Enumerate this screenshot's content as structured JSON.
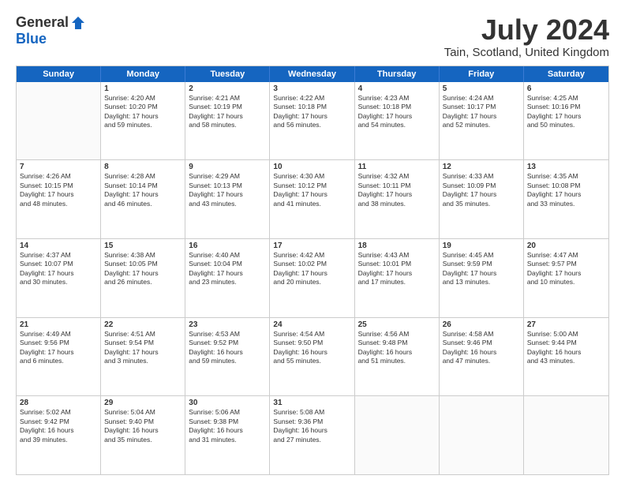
{
  "header": {
    "logo_general": "General",
    "logo_blue": "Blue",
    "month_title": "July 2024",
    "location": "Tain, Scotland, United Kingdom"
  },
  "days_of_week": [
    "Sunday",
    "Monday",
    "Tuesday",
    "Wednesday",
    "Thursday",
    "Friday",
    "Saturday"
  ],
  "weeks": [
    [
      {
        "day": "",
        "empty": true,
        "lines": []
      },
      {
        "day": "1",
        "lines": [
          "Sunrise: 4:20 AM",
          "Sunset: 10:20 PM",
          "Daylight: 17 hours",
          "and 59 minutes."
        ]
      },
      {
        "day": "2",
        "lines": [
          "Sunrise: 4:21 AM",
          "Sunset: 10:19 PM",
          "Daylight: 17 hours",
          "and 58 minutes."
        ]
      },
      {
        "day": "3",
        "lines": [
          "Sunrise: 4:22 AM",
          "Sunset: 10:18 PM",
          "Daylight: 17 hours",
          "and 56 minutes."
        ]
      },
      {
        "day": "4",
        "lines": [
          "Sunrise: 4:23 AM",
          "Sunset: 10:18 PM",
          "Daylight: 17 hours",
          "and 54 minutes."
        ]
      },
      {
        "day": "5",
        "lines": [
          "Sunrise: 4:24 AM",
          "Sunset: 10:17 PM",
          "Daylight: 17 hours",
          "and 52 minutes."
        ]
      },
      {
        "day": "6",
        "lines": [
          "Sunrise: 4:25 AM",
          "Sunset: 10:16 PM",
          "Daylight: 17 hours",
          "and 50 minutes."
        ]
      }
    ],
    [
      {
        "day": "7",
        "lines": [
          "Sunrise: 4:26 AM",
          "Sunset: 10:15 PM",
          "Daylight: 17 hours",
          "and 48 minutes."
        ]
      },
      {
        "day": "8",
        "lines": [
          "Sunrise: 4:28 AM",
          "Sunset: 10:14 PM",
          "Daylight: 17 hours",
          "and 46 minutes."
        ]
      },
      {
        "day": "9",
        "lines": [
          "Sunrise: 4:29 AM",
          "Sunset: 10:13 PM",
          "Daylight: 17 hours",
          "and 43 minutes."
        ]
      },
      {
        "day": "10",
        "lines": [
          "Sunrise: 4:30 AM",
          "Sunset: 10:12 PM",
          "Daylight: 17 hours",
          "and 41 minutes."
        ]
      },
      {
        "day": "11",
        "lines": [
          "Sunrise: 4:32 AM",
          "Sunset: 10:11 PM",
          "Daylight: 17 hours",
          "and 38 minutes."
        ]
      },
      {
        "day": "12",
        "lines": [
          "Sunrise: 4:33 AM",
          "Sunset: 10:09 PM",
          "Daylight: 17 hours",
          "and 35 minutes."
        ]
      },
      {
        "day": "13",
        "lines": [
          "Sunrise: 4:35 AM",
          "Sunset: 10:08 PM",
          "Daylight: 17 hours",
          "and 33 minutes."
        ]
      }
    ],
    [
      {
        "day": "14",
        "lines": [
          "Sunrise: 4:37 AM",
          "Sunset: 10:07 PM",
          "Daylight: 17 hours",
          "and 30 minutes."
        ]
      },
      {
        "day": "15",
        "lines": [
          "Sunrise: 4:38 AM",
          "Sunset: 10:05 PM",
          "Daylight: 17 hours",
          "and 26 minutes."
        ]
      },
      {
        "day": "16",
        "lines": [
          "Sunrise: 4:40 AM",
          "Sunset: 10:04 PM",
          "Daylight: 17 hours",
          "and 23 minutes."
        ]
      },
      {
        "day": "17",
        "lines": [
          "Sunrise: 4:42 AM",
          "Sunset: 10:02 PM",
          "Daylight: 17 hours",
          "and 20 minutes."
        ]
      },
      {
        "day": "18",
        "lines": [
          "Sunrise: 4:43 AM",
          "Sunset: 10:01 PM",
          "Daylight: 17 hours",
          "and 17 minutes."
        ]
      },
      {
        "day": "19",
        "lines": [
          "Sunrise: 4:45 AM",
          "Sunset: 9:59 PM",
          "Daylight: 17 hours",
          "and 13 minutes."
        ]
      },
      {
        "day": "20",
        "lines": [
          "Sunrise: 4:47 AM",
          "Sunset: 9:57 PM",
          "Daylight: 17 hours",
          "and 10 minutes."
        ]
      }
    ],
    [
      {
        "day": "21",
        "lines": [
          "Sunrise: 4:49 AM",
          "Sunset: 9:56 PM",
          "Daylight: 17 hours",
          "and 6 minutes."
        ]
      },
      {
        "day": "22",
        "lines": [
          "Sunrise: 4:51 AM",
          "Sunset: 9:54 PM",
          "Daylight: 17 hours",
          "and 3 minutes."
        ]
      },
      {
        "day": "23",
        "lines": [
          "Sunrise: 4:53 AM",
          "Sunset: 9:52 PM",
          "Daylight: 16 hours",
          "and 59 minutes."
        ]
      },
      {
        "day": "24",
        "lines": [
          "Sunrise: 4:54 AM",
          "Sunset: 9:50 PM",
          "Daylight: 16 hours",
          "and 55 minutes."
        ]
      },
      {
        "day": "25",
        "lines": [
          "Sunrise: 4:56 AM",
          "Sunset: 9:48 PM",
          "Daylight: 16 hours",
          "and 51 minutes."
        ]
      },
      {
        "day": "26",
        "lines": [
          "Sunrise: 4:58 AM",
          "Sunset: 9:46 PM",
          "Daylight: 16 hours",
          "and 47 minutes."
        ]
      },
      {
        "day": "27",
        "lines": [
          "Sunrise: 5:00 AM",
          "Sunset: 9:44 PM",
          "Daylight: 16 hours",
          "and 43 minutes."
        ]
      }
    ],
    [
      {
        "day": "28",
        "lines": [
          "Sunrise: 5:02 AM",
          "Sunset: 9:42 PM",
          "Daylight: 16 hours",
          "and 39 minutes."
        ]
      },
      {
        "day": "29",
        "lines": [
          "Sunrise: 5:04 AM",
          "Sunset: 9:40 PM",
          "Daylight: 16 hours",
          "and 35 minutes."
        ]
      },
      {
        "day": "30",
        "lines": [
          "Sunrise: 5:06 AM",
          "Sunset: 9:38 PM",
          "Daylight: 16 hours",
          "and 31 minutes."
        ]
      },
      {
        "day": "31",
        "lines": [
          "Sunrise: 5:08 AM",
          "Sunset: 9:36 PM",
          "Daylight: 16 hours",
          "and 27 minutes."
        ]
      },
      {
        "day": "",
        "empty": true,
        "lines": []
      },
      {
        "day": "",
        "empty": true,
        "lines": []
      },
      {
        "day": "",
        "empty": true,
        "lines": []
      }
    ]
  ]
}
